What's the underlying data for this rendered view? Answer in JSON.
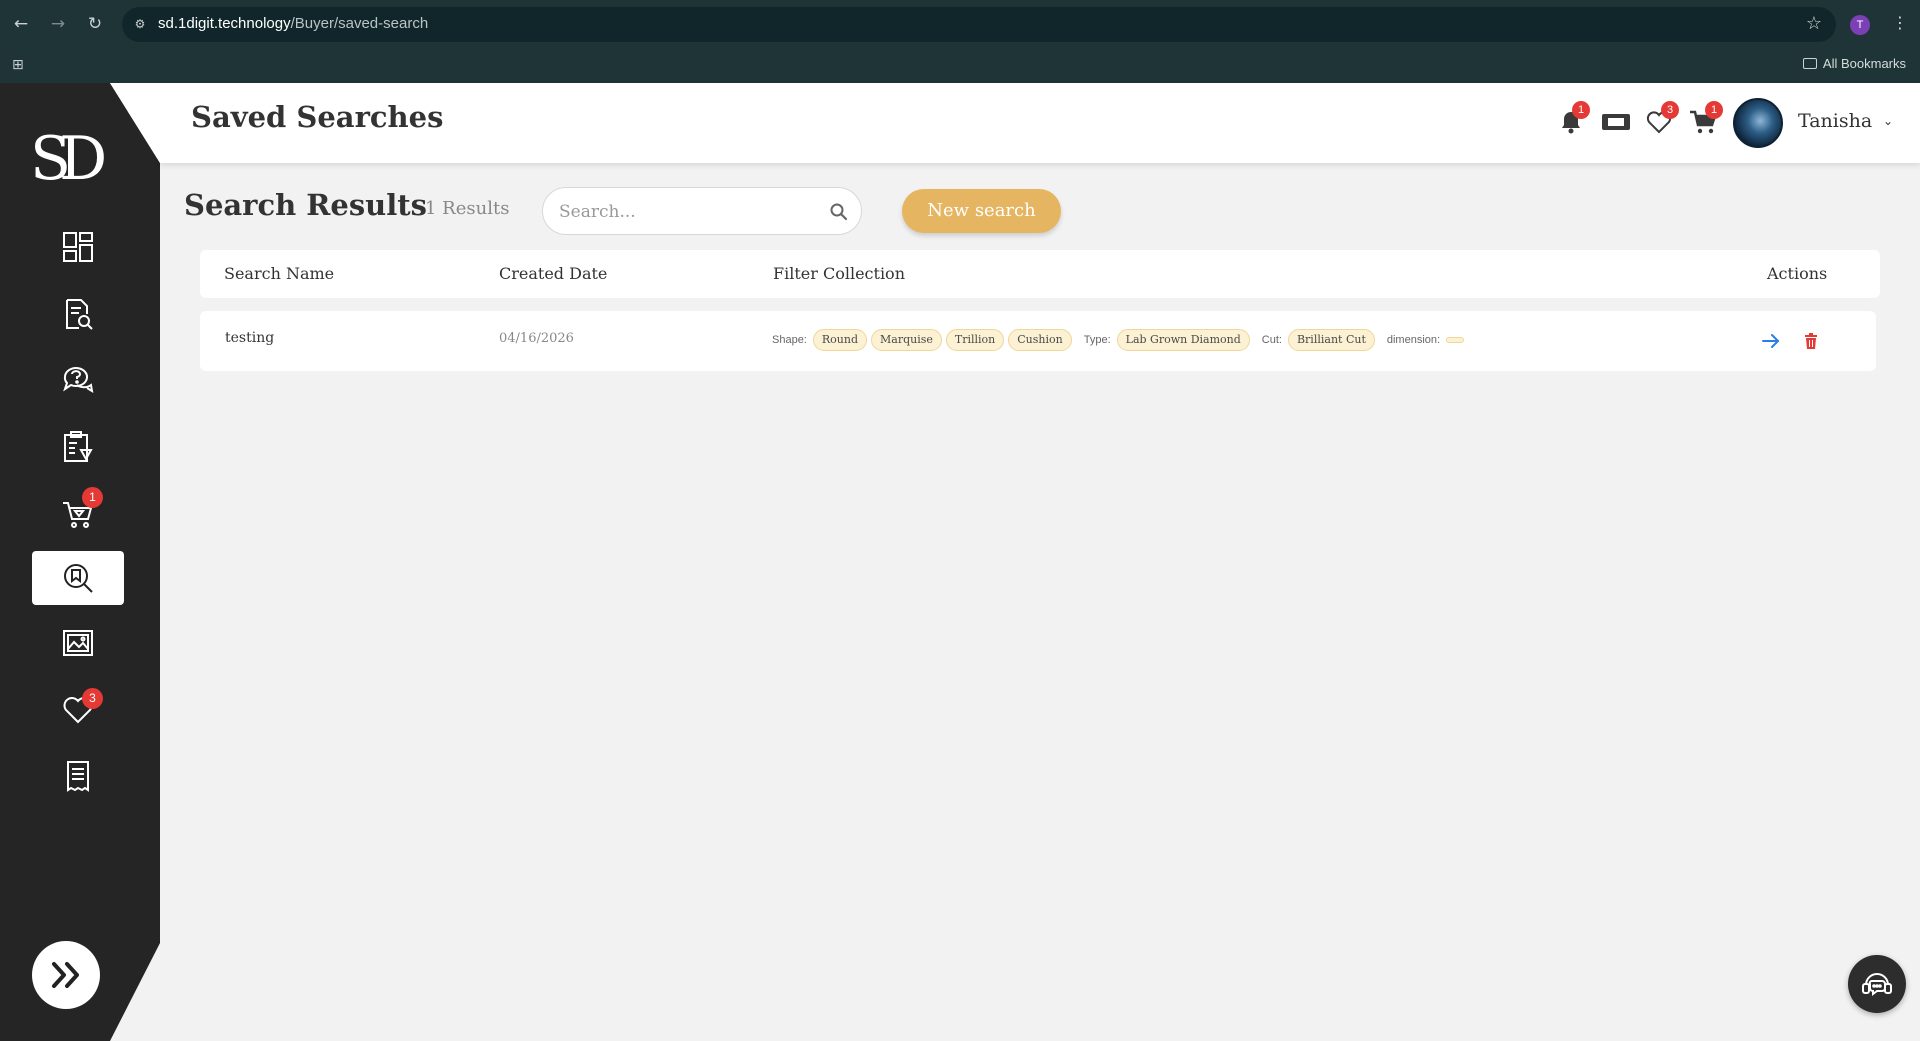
{
  "browser": {
    "url_host": "sd.1digit.technology",
    "url_path": "/Buyer/saved-search",
    "profile_initial": "T",
    "bookmarks_label": "All Bookmarks"
  },
  "sidebar": {
    "logo_text": "SD",
    "items": [
      {
        "name": "dashboard",
        "icon": "dashboard-icon",
        "active": false,
        "badge": ""
      },
      {
        "name": "search",
        "icon": "document-search-icon",
        "active": false,
        "badge": ""
      },
      {
        "name": "inquiries",
        "icon": "chat-question-icon",
        "active": false,
        "badge": ""
      },
      {
        "name": "orders",
        "icon": "clipboard-diamond-icon",
        "active": false,
        "badge": ""
      },
      {
        "name": "cart",
        "icon": "cart-diamond-icon",
        "active": false,
        "badge": "1"
      },
      {
        "name": "saved-search",
        "icon": "saved-search-icon",
        "active": true,
        "badge": ""
      },
      {
        "name": "gallery",
        "icon": "image-gallery-icon",
        "active": false,
        "badge": ""
      },
      {
        "name": "wishlist",
        "icon": "heart-icon",
        "active": false,
        "badge": "3"
      },
      {
        "name": "invoices",
        "icon": "receipt-icon",
        "active": false,
        "badge": ""
      }
    ]
  },
  "header": {
    "title": "Saved Searches",
    "notifications_badge": "1",
    "wishlist_badge": "3",
    "cart_badge": "1",
    "user_name": "Tanisha"
  },
  "main": {
    "results_title": "Search Results",
    "results_count": "1 Results",
    "search_placeholder": "Search...",
    "new_search_label": "New search",
    "columns": [
      "Search Name",
      "Created Date",
      "Filter Collection",
      "Actions"
    ],
    "rows": [
      {
        "name": "testing",
        "created": "04/16/2026",
        "filters": [
          {
            "label": "Shape:",
            "values": [
              "Round",
              "Marquise",
              "Trillion",
              "Cushion"
            ]
          },
          {
            "label": "Type:",
            "values": [
              "Lab Grown Diamond"
            ]
          },
          {
            "label": "Cut:",
            "values": [
              "Brilliant Cut"
            ]
          },
          {
            "label": "dimension:",
            "values": [
              ""
            ]
          }
        ]
      }
    ]
  },
  "colors": {
    "accent": "#e6b561",
    "sidebar_bg": "#252525",
    "badge": "#e53935",
    "chip_bg": "#fcf1d2",
    "chip_border": "#efd79a",
    "action_view": "#2b7de9",
    "action_delete": "#e53935"
  }
}
